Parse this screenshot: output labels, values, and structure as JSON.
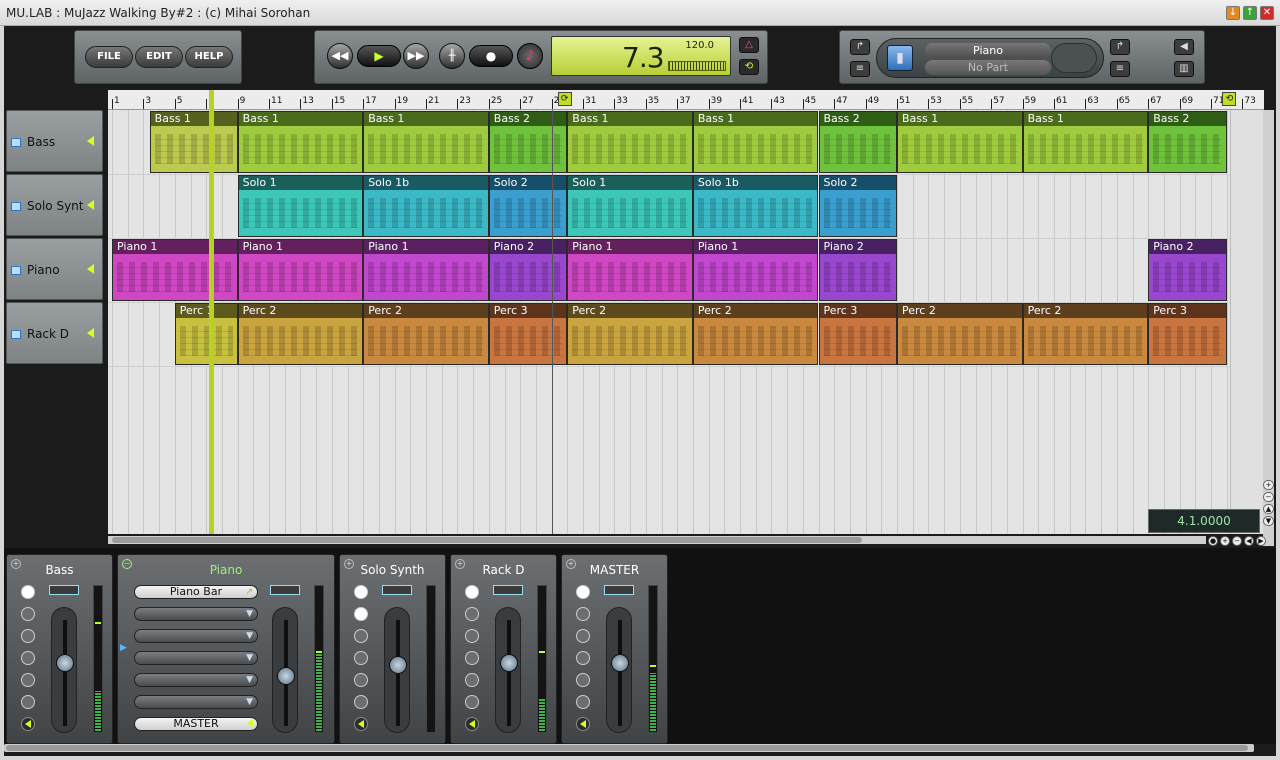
{
  "window": {
    "title": "MU.LAB : MuJazz Walking By#2 : (c) Mihai Sorohan",
    "controls": [
      "↓",
      "↑",
      "✕"
    ]
  },
  "menu": {
    "file": "FILE",
    "edit": "EDIT",
    "help": "HELP"
  },
  "transport": {
    "rewind_icon": "rewind-icon",
    "play_icon": "play-icon",
    "forward_icon": "fast-forward-icon",
    "position": "7.3",
    "tempo": "120.0",
    "glyphs": {
      "rewind": "◀◀",
      "play": "▶",
      "forward": "▶▶",
      "scrub": "╫",
      "record": "●",
      "metronome": "♪",
      "marker": "△",
      "loop": "⟲"
    }
  },
  "part_panel": {
    "instrument": "Piano",
    "part": "No Part",
    "glyphs": {
      "back": "↱",
      "list": "≡",
      "speaker": "◀",
      "colors": "▥"
    }
  },
  "ruler": {
    "bars": [
      "1",
      "3",
      "5",
      "7",
      "9",
      "11",
      "13",
      "15",
      "17",
      "19",
      "21",
      "23",
      "25",
      "27",
      "29",
      "31",
      "33",
      "35",
      "37",
      "39",
      "41",
      "43",
      "45",
      "47",
      "49",
      "51",
      "53",
      "55",
      "57",
      "59",
      "61",
      "63",
      "65",
      "67",
      "69",
      "71",
      "73"
    ],
    "loop_start": "29",
    "loop_end": "73"
  },
  "tracks": [
    {
      "name": "Bass",
      "lane": 0
    },
    {
      "name": "Solo Synt",
      "lane": 1
    },
    {
      "name": "Piano",
      "lane": 2
    },
    {
      "name": "Rack D",
      "lane": 3
    }
  ],
  "clips": [
    {
      "lane": 0,
      "label": "Bass 1",
      "bar_start": 3.4,
      "bar_end": 9,
      "color": "#bccb4f",
      "head": "#55611f"
    },
    {
      "lane": 0,
      "label": "Bass 1",
      "bar_start": 9,
      "bar_end": 17,
      "color": "#9fcc3f",
      "head": "#4a6a1c"
    },
    {
      "lane": 0,
      "label": "Bass 1",
      "bar_start": 17,
      "bar_end": 25,
      "color": "#9fcc3f",
      "head": "#4a6a1c"
    },
    {
      "lane": 0,
      "label": "Bass 2",
      "bar_start": 25,
      "bar_end": 30,
      "color": "#6fc23c",
      "head": "#2f5d16"
    },
    {
      "lane": 0,
      "label": "Bass 1",
      "bar_start": 30,
      "bar_end": 38,
      "color": "#9fcc3f",
      "head": "#4a6a1c"
    },
    {
      "lane": 0,
      "label": "Bass 1",
      "bar_start": 38,
      "bar_end": 46,
      "color": "#9fcc3f",
      "head": "#4a6a1c"
    },
    {
      "lane": 0,
      "label": "Bass 2",
      "bar_start": 46,
      "bar_end": 51,
      "color": "#6fc23c",
      "head": "#2f5d16"
    },
    {
      "lane": 0,
      "label": "Bass 1",
      "bar_start": 51,
      "bar_end": 59,
      "color": "#9fcc3f",
      "head": "#4a6a1c"
    },
    {
      "lane": 0,
      "label": "Bass 1",
      "bar_start": 59,
      "bar_end": 67,
      "color": "#9fcc3f",
      "head": "#4a6a1c"
    },
    {
      "lane": 0,
      "label": "Bass 2",
      "bar_start": 67,
      "bar_end": 72,
      "color": "#6fc23c",
      "head": "#2f5d16"
    },
    {
      "lane": 1,
      "label": "Solo 1",
      "bar_start": 9,
      "bar_end": 17,
      "color": "#3dc7b9",
      "head": "#1a5f5a"
    },
    {
      "lane": 1,
      "label": "Solo 1b",
      "bar_start": 17,
      "bar_end": 25,
      "color": "#3bb9c7",
      "head": "#1a5a62"
    },
    {
      "lane": 1,
      "label": "Solo 2",
      "bar_start": 25,
      "bar_end": 30,
      "color": "#3a9fcf",
      "head": "#174f6b"
    },
    {
      "lane": 1,
      "label": "Solo 1",
      "bar_start": 30,
      "bar_end": 38,
      "color": "#3dc7b9",
      "head": "#1a5f5a"
    },
    {
      "lane": 1,
      "label": "Solo 1b",
      "bar_start": 38,
      "bar_end": 46,
      "color": "#3bb9c7",
      "head": "#1a5a62"
    },
    {
      "lane": 1,
      "label": "Solo 2",
      "bar_start": 46,
      "bar_end": 51,
      "color": "#3a9fcf",
      "head": "#174f6b"
    },
    {
      "lane": 2,
      "label": "Piano 1",
      "bar_start": 1,
      "bar_end": 9,
      "color": "#cf47c2",
      "head": "#62215c"
    },
    {
      "lane": 2,
      "label": "Piano 1",
      "bar_start": 9,
      "bar_end": 17,
      "color": "#cf47c2",
      "head": "#62215c"
    },
    {
      "lane": 2,
      "label": "Piano 1",
      "bar_start": 17,
      "bar_end": 25,
      "color": "#c247cf",
      "head": "#5a2162"
    },
    {
      "lane": 2,
      "label": "Piano 2",
      "bar_start": 25,
      "bar_end": 30,
      "color": "#9a47cf",
      "head": "#482162"
    },
    {
      "lane": 2,
      "label": "Piano 1",
      "bar_start": 30,
      "bar_end": 38,
      "color": "#cf47c2",
      "head": "#62215c"
    },
    {
      "lane": 2,
      "label": "Piano 1",
      "bar_start": 38,
      "bar_end": 46,
      "color": "#c247cf",
      "head": "#5a2162"
    },
    {
      "lane": 2,
      "label": "Piano 2",
      "bar_start": 46,
      "bar_end": 51,
      "color": "#9a47cf",
      "head": "#482162"
    },
    {
      "lane": 2,
      "label": "Piano 2",
      "bar_start": 67,
      "bar_end": 72,
      "color": "#9a47cf",
      "head": "#482162"
    },
    {
      "lane": 3,
      "label": "Perc 1",
      "bar_start": 5,
      "bar_end": 9,
      "color": "#c8c03f",
      "head": "#5e5a1d"
    },
    {
      "lane": 3,
      "label": "Perc 2",
      "bar_start": 9,
      "bar_end": 17,
      "color": "#c9a43f",
      "head": "#5e4b1d"
    },
    {
      "lane": 3,
      "label": "Perc 2",
      "bar_start": 17,
      "bar_end": 25,
      "color": "#c9893f",
      "head": "#5e3f1d"
    },
    {
      "lane": 3,
      "label": "Perc 3",
      "bar_start": 25,
      "bar_end": 30,
      "color": "#c9753f",
      "head": "#5e341d"
    },
    {
      "lane": 3,
      "label": "Perc 2",
      "bar_start": 30,
      "bar_end": 38,
      "color": "#c9a43f",
      "head": "#5e4b1d"
    },
    {
      "lane": 3,
      "label": "Perc 2",
      "bar_start": 38,
      "bar_end": 46,
      "color": "#c9893f",
      "head": "#5e3f1d"
    },
    {
      "lane": 3,
      "label": "Perc 3",
      "bar_start": 46,
      "bar_end": 51,
      "color": "#c9753f",
      "head": "#5e341d"
    },
    {
      "lane": 3,
      "label": "Perc 2",
      "bar_start": 51,
      "bar_end": 59,
      "color": "#c9893f",
      "head": "#5e3f1d"
    },
    {
      "lane": 3,
      "label": "Perc 2",
      "bar_start": 59,
      "bar_end": 67,
      "color": "#c9893f",
      "head": "#5e3f1d"
    },
    {
      "lane": 3,
      "label": "Perc 3",
      "bar_start": 67,
      "bar_end": 72,
      "color": "#c9753f",
      "head": "#5e341d"
    }
  ],
  "playhead_bar": 7.3,
  "song_position_display": "4.1.0000",
  "mixer": {
    "strips": [
      {
        "name": "Bass",
        "active": false,
        "fader": 0.62,
        "meter": 0.28,
        "peak": 0.75
      },
      {
        "name": "Piano",
        "active": true,
        "fader": 0.48,
        "meter": 0.55,
        "peak": 0.55,
        "slots": [
          "Piano Bar",
          "",
          "",
          "",
          "",
          ""
        ],
        "output": "MASTER"
      },
      {
        "name": "Solo Synth",
        "active": false,
        "fader": 0.6,
        "meter": 0.0,
        "peak": 0.0
      },
      {
        "name": "Rack D",
        "active": false,
        "fader": 0.62,
        "meter": 0.22,
        "peak": 0.55
      },
      {
        "name": "MASTER",
        "active": false,
        "fader": 0.62,
        "meter": 0.4,
        "peak": 0.45
      }
    ]
  }
}
